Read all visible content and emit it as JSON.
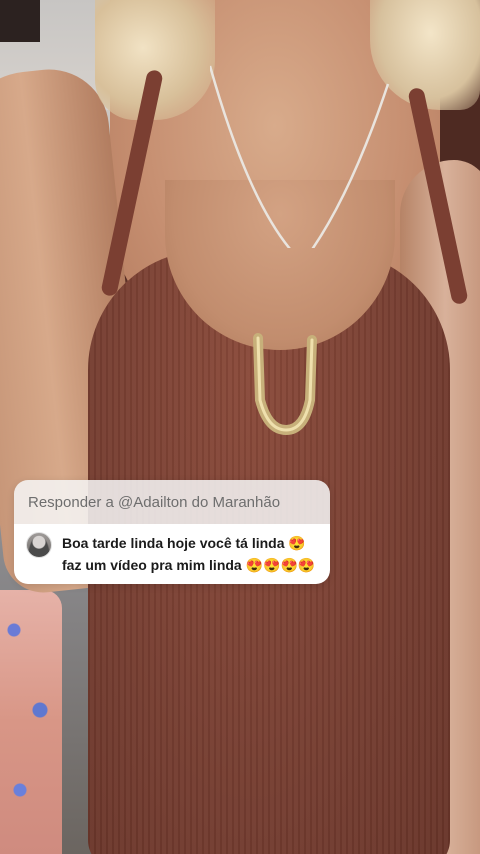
{
  "reply_sticker": {
    "header": "Responder a @Adailton do Maranhão",
    "comment_lines": [
      "Boa tarde linda hoje você tá linda 😍",
      "faz um vídeo pra mim linda 😍😍😍😍"
    ],
    "avatar_icon": "user-avatar-icon"
  },
  "colors": {
    "sticker_header_bg": "#f6f6f6",
    "sticker_body_bg": "#ffffff",
    "header_text": "#6e6e6e",
    "comment_text": "#1b1b1b"
  }
}
